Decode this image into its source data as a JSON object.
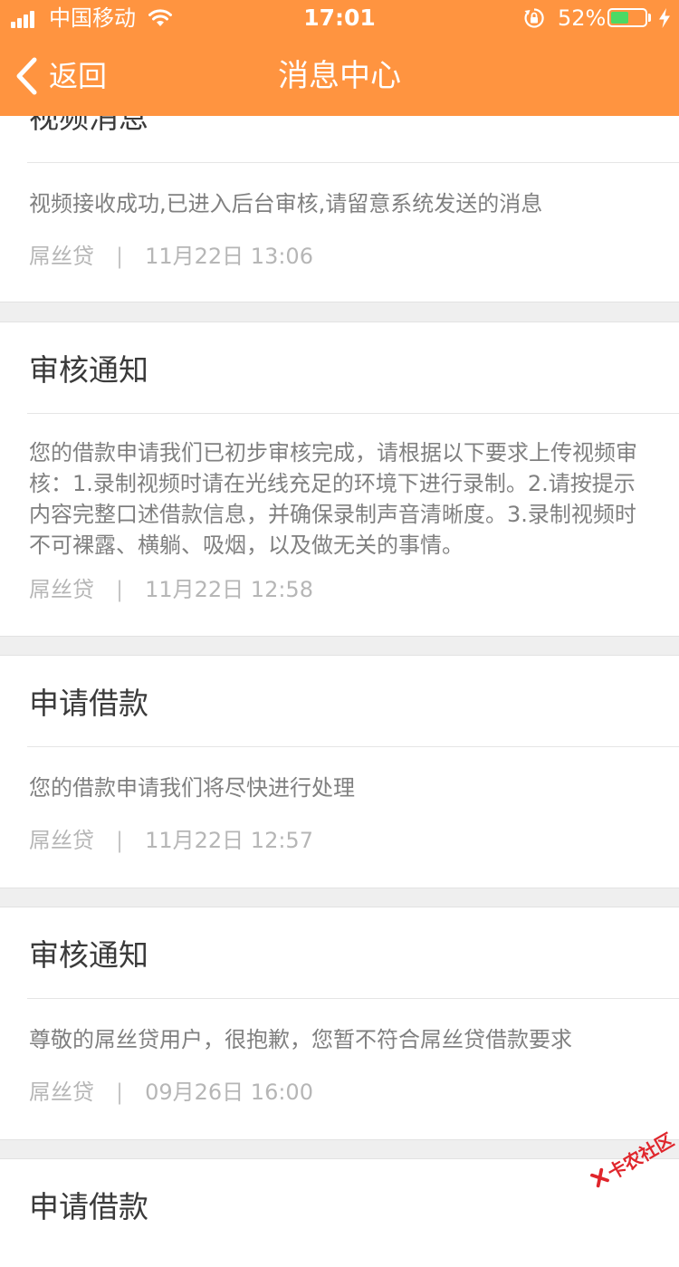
{
  "status_bar": {
    "carrier": "中国移动",
    "time": "17:01",
    "battery_percent": "52%",
    "battery_level": 0.52
  },
  "nav": {
    "back_label": "返回",
    "title": "消息中心"
  },
  "messages": [
    {
      "title": "视频消息",
      "body": "视频接收成功,已进入后台审核,请留意系统发送的消息",
      "source": "屌丝贷",
      "time": "11月22日 13:06"
    },
    {
      "title": "审核通知",
      "body": "您的借款申请我们已初步审核完成，请根据以下要求上传视频审核：1.录制视频时请在光线充足的环境下进行录制。2.请按提示内容完整口述借款信息，并确保录制声音清晰度。3.录制视频时不可裸露、横躺、吸烟，以及做无关的事情。",
      "source": "屌丝贷",
      "time": "11月22日 12:58"
    },
    {
      "title": "申请借款",
      "body": "您的借款申请我们将尽快进行处理",
      "source": "屌丝贷",
      "time": "11月22日 12:57"
    },
    {
      "title": "审核通知",
      "body": "尊敬的屌丝贷用户，很抱歉，您暂不符合屌丝贷借款要求",
      "source": "屌丝贷",
      "time": "09月26日 16:00"
    },
    {
      "title": "申请借款",
      "body": "",
      "source": "",
      "time": ""
    }
  ],
  "meta_separator": "|",
  "watermark": {
    "text": "卡农社区"
  },
  "colors": {
    "header": "#ff9440",
    "battery_fill": "#4cd964",
    "watermark": "#e0262c"
  }
}
